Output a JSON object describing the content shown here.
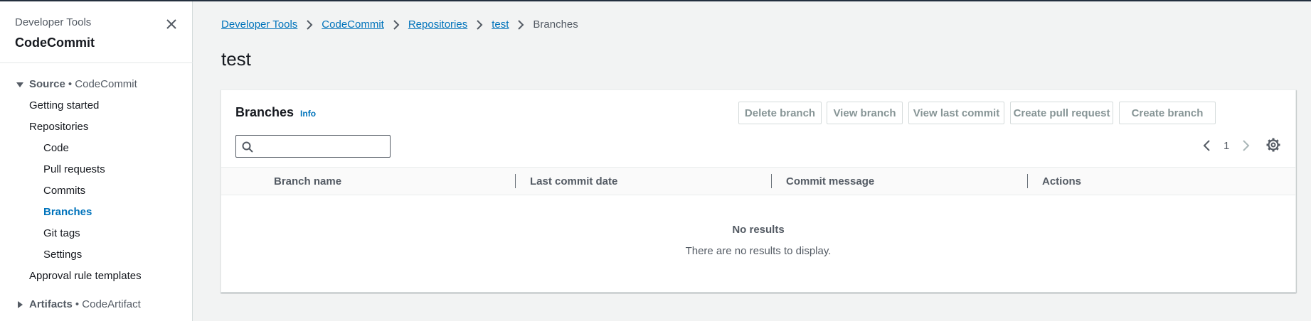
{
  "sidebar": {
    "service": "Developer Tools",
    "title": "CodeCommit",
    "sections": [
      {
        "label": "Source",
        "sub": "• CodeCommit"
      },
      {
        "label": "Artifacts",
        "sub": "• CodeArtifact"
      }
    ],
    "items": [
      {
        "label": "Getting started"
      },
      {
        "label": "Repositories"
      },
      {
        "label": "Code"
      },
      {
        "label": "Pull requests"
      },
      {
        "label": "Commits"
      },
      {
        "label": "Branches"
      },
      {
        "label": "Git tags"
      },
      {
        "label": "Settings"
      },
      {
        "label": "Approval rule templates"
      }
    ],
    "active_item": "Branches"
  },
  "breadcrumb": {
    "items": [
      "Developer Tools",
      "CodeCommit",
      "Repositories",
      "test"
    ],
    "current": "Branches"
  },
  "page": {
    "title": "test"
  },
  "panel": {
    "title": "Branches",
    "info": "Info",
    "buttons": {
      "delete": "Delete branch",
      "view": "View branch",
      "view_last_commit": "View last commit",
      "create_pr": "Create pull request",
      "create_branch": "Create branch"
    },
    "search": {
      "value": "",
      "placeholder": ""
    },
    "pager": {
      "page": "1"
    },
    "columns": [
      "Branch name",
      "Last commit date",
      "Commit message",
      "Actions"
    ],
    "empty": {
      "title": "No results",
      "text": "There are no results to display."
    }
  },
  "colors": {
    "accent": "#0073bb",
    "header_bar": "#232f3e",
    "disabled_text": "#879596"
  },
  "icons": [
    "close-icon",
    "caret-down-icon",
    "caret-right-icon",
    "chevron-right-icon",
    "search-icon",
    "chevron-left-icon",
    "gear-icon"
  ]
}
